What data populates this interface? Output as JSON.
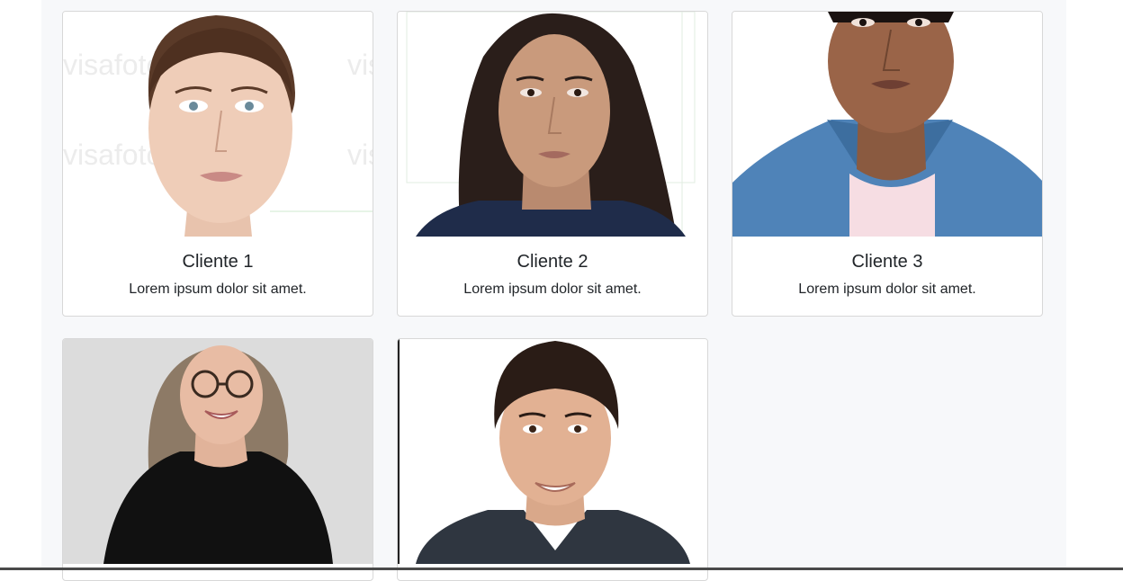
{
  "cards": [
    {
      "title": "Cliente 1",
      "text": "Lorem ipsum dolor sit amet.",
      "photo": "woman-short-brown-hair-portrait",
      "watermark": "visafoto"
    },
    {
      "title": "Cliente 2",
      "text": "Lorem ipsum dolor sit amet.",
      "photo": "woman-long-dark-hair-portrait"
    },
    {
      "title": "Cliente 3",
      "text": "Lorem ipsum dolor sit amet.",
      "photo": "young-man-denim-shirt-portrait"
    },
    {
      "title": "",
      "text": "",
      "photo": "woman-glasses-black-top-portrait"
    },
    {
      "title": "",
      "text": "",
      "photo": "man-dark-suit-portrait"
    }
  ],
  "colors": {
    "page_bg": "#ffffff",
    "container_bg": "#f7f8fa",
    "card_border": "#d8d8d8",
    "text": "#212529"
  }
}
